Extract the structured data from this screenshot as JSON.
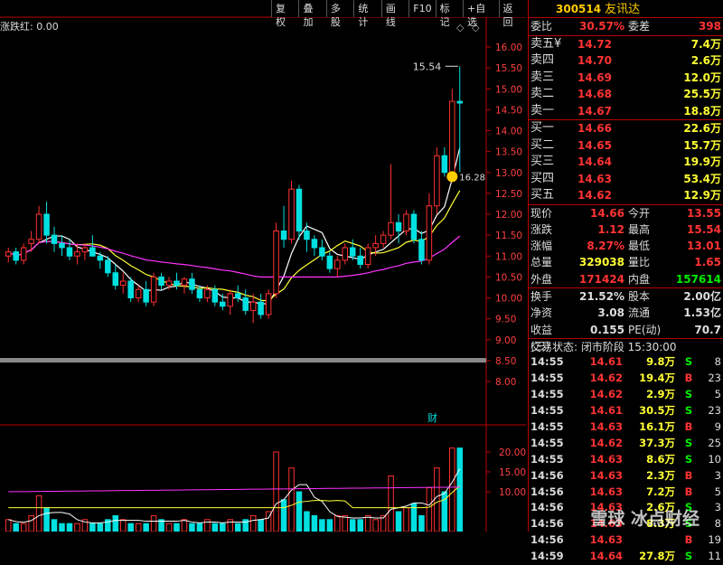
{
  "toolbar": [
    "复权",
    "叠加",
    "多股",
    "统计",
    "画线",
    "F10",
    "标记",
    "+自选",
    "返回"
  ],
  "chart": {
    "indicator_label": "涨跌红: 0.00",
    "y_ticks": [
      "16.00",
      "15.50",
      "15.00",
      "14.50",
      "14.00",
      "13.50",
      "13.00",
      "12.50",
      "12.00",
      "11.50",
      "11.00",
      "10.50",
      "10.00",
      "9.50",
      "9.00",
      "8.50",
      "8.00"
    ],
    "vol_ticks": [
      "20.00",
      "15.00",
      "10.00"
    ],
    "high_annotation": "15.54",
    "ma_annotation": "16.28",
    "fin_marker": "财",
    "colors": {
      "up": "#ff3030",
      "down": "#00e0e0",
      "ma1": "#ffffff",
      "ma2": "#ffff33",
      "ma3": "#ff33ff"
    }
  },
  "stock": {
    "code": "300514",
    "name": "友讯达"
  },
  "order_book": {
    "weibi_label": "委比",
    "weibi_value": "30.57%",
    "weicha_label": "委差",
    "weicha_value": "398",
    "asks": [
      {
        "label": "卖五",
        "price": "14.72",
        "vol": "7.4万",
        "mark": "¥"
      },
      {
        "label": "卖四",
        "price": "14.70",
        "vol": "2.6万",
        "mark": ""
      },
      {
        "label": "卖三",
        "price": "14.69",
        "vol": "12.0万",
        "mark": ""
      },
      {
        "label": "卖二",
        "price": "14.68",
        "vol": "25.5万",
        "mark": ""
      },
      {
        "label": "卖一",
        "price": "14.67",
        "vol": "18.8万",
        "mark": ""
      }
    ],
    "bids": [
      {
        "label": "买一",
        "price": "14.66",
        "vol": "22.6万"
      },
      {
        "label": "买二",
        "price": "14.65",
        "vol": "15.7万"
      },
      {
        "label": "买三",
        "price": "14.64",
        "vol": "19.9万"
      },
      {
        "label": "买四",
        "price": "14.63",
        "vol": "53.4万"
      },
      {
        "label": "买五",
        "price": "14.62",
        "vol": "12.9万"
      }
    ]
  },
  "quote": [
    {
      "k1": "现价",
      "v1": "14.66",
      "c1": "red",
      "k2": "今开",
      "v2": "13.55",
      "c2": "red"
    },
    {
      "k1": "涨跌",
      "v1": "1.12",
      "c1": "red",
      "k2": "最高",
      "v2": "15.54",
      "c2": "red"
    },
    {
      "k1": "涨幅",
      "v1": "8.27%",
      "c1": "red",
      "k2": "最低",
      "v2": "13.01",
      "c2": "red"
    },
    {
      "k1": "总量",
      "v1": "329038",
      "c1": "yellow",
      "k2": "量比",
      "v2": "1.65",
      "c2": "red"
    },
    {
      "k1": "外盘",
      "v1": "171424",
      "c1": "red",
      "k2": "内盘",
      "v2": "157614",
      "c2": "green"
    }
  ],
  "quote2": [
    {
      "k1": "换手",
      "v1": "21.52%",
      "k2": "股本",
      "v2": "2.00亿"
    },
    {
      "k1": "净资",
      "v1": "3.08",
      "k2": "流通",
      "v2": "1.53亿"
    },
    {
      "k1": "收益(三)",
      "v1": "0.155",
      "k2": "PE(动)",
      "v2": "70.7"
    }
  ],
  "trade_status": "交易状态: 闭市阶段 15:30:00",
  "trades": [
    {
      "t": "14:55",
      "p": "14.61",
      "v": "9.8万",
      "bs": "S",
      "n": "8"
    },
    {
      "t": "14:55",
      "p": "14.62",
      "v": "19.4万",
      "bs": "B",
      "n": "23"
    },
    {
      "t": "14:55",
      "p": "14.62",
      "v": "2.9万",
      "bs": "S",
      "n": "5"
    },
    {
      "t": "14:55",
      "p": "14.61",
      "v": "30.5万",
      "bs": "S",
      "n": "23"
    },
    {
      "t": "14:55",
      "p": "14.63",
      "v": "16.1万",
      "bs": "B",
      "n": "9"
    },
    {
      "t": "14:55",
      "p": "14.62",
      "v": "37.3万",
      "bs": "S",
      "n": "25"
    },
    {
      "t": "14:55",
      "p": "14.63",
      "v": "8.6万",
      "bs": "S",
      "n": "10"
    },
    {
      "t": "14:56",
      "p": "14.63",
      "v": "2.3万",
      "bs": "B",
      "n": "3"
    },
    {
      "t": "14:56",
      "p": "14.63",
      "v": "7.2万",
      "bs": "B",
      "n": "5"
    },
    {
      "t": "14:56",
      "p": "14.63",
      "v": "2.6万",
      "bs": "S",
      "n": "3"
    },
    {
      "t": "14:56",
      "p": "14.63",
      "v": "8.3万",
      "bs": "S",
      "n": "8"
    },
    {
      "t": "14:56",
      "p": "14.63",
      "v": "",
      "bs": "B",
      "n": "19"
    },
    {
      "t": "14:59",
      "p": "14.64",
      "v": "27.8万",
      "bs": "S",
      "n": "11"
    }
  ],
  "watermark": "雪球 冰点财经",
  "chart_data": {
    "type": "candlestick",
    "ohlc": [
      [
        11.0,
        11.2,
        10.85,
        11.1
      ],
      [
        11.1,
        11.2,
        10.8,
        10.9
      ],
      [
        10.9,
        11.3,
        10.8,
        11.2
      ],
      [
        11.3,
        11.6,
        11.1,
        11.4
      ],
      [
        11.4,
        12.2,
        11.3,
        12.0
      ],
      [
        12.0,
        12.3,
        11.3,
        11.5
      ],
      [
        11.5,
        11.7,
        11.1,
        11.3
      ],
      [
        11.3,
        11.5,
        11.0,
        11.2
      ],
      [
        11.2,
        11.4,
        10.9,
        11.0
      ],
      [
        11.0,
        11.3,
        10.8,
        11.1
      ],
      [
        11.1,
        11.3,
        10.9,
        11.2
      ],
      [
        11.2,
        11.5,
        11.1,
        11.0
      ],
      [
        11.0,
        11.1,
        10.7,
        10.9
      ],
      [
        10.9,
        11.0,
        10.5,
        10.6
      ],
      [
        10.6,
        10.8,
        10.2,
        10.3
      ],
      [
        10.3,
        10.6,
        10.1,
        10.4
      ],
      [
        10.4,
        10.5,
        9.9,
        10.0
      ],
      [
        10.0,
        10.3,
        9.9,
        10.2
      ],
      [
        10.2,
        10.4,
        9.8,
        9.9
      ],
      [
        9.9,
        10.6,
        9.8,
        10.5
      ],
      [
        10.5,
        10.6,
        10.2,
        10.3
      ],
      [
        10.3,
        10.5,
        10.2,
        10.4
      ],
      [
        10.4,
        10.6,
        10.2,
        10.3
      ],
      [
        10.3,
        10.5,
        10.1,
        10.45
      ],
      [
        10.45,
        10.6,
        10.1,
        10.2
      ],
      [
        10.2,
        10.3,
        9.9,
        10.0
      ],
      [
        10.0,
        10.3,
        9.9,
        10.2
      ],
      [
        10.2,
        10.3,
        9.8,
        9.9
      ],
      [
        9.9,
        10.1,
        9.7,
        9.8
      ],
      [
        9.8,
        10.2,
        9.6,
        10.1
      ],
      [
        10.1,
        10.3,
        9.9,
        10.0
      ],
      [
        10.0,
        10.2,
        9.6,
        9.7
      ],
      [
        9.7,
        10.1,
        9.4,
        9.9
      ],
      [
        9.9,
        10.1,
        9.5,
        9.6
      ],
      [
        9.6,
        10.2,
        9.5,
        10.1
      ],
      [
        10.1,
        11.8,
        10.0,
        11.6
      ],
      [
        11.6,
        12.2,
        11.2,
        11.4
      ],
      [
        11.4,
        12.8,
        11.3,
        12.6
      ],
      [
        12.6,
        12.7,
        11.4,
        11.6
      ],
      [
        11.6,
        11.8,
        11.1,
        11.4
      ],
      [
        11.4,
        11.5,
        11.0,
        11.2
      ],
      [
        11.2,
        11.4,
        10.9,
        11.0
      ],
      [
        11.0,
        11.1,
        10.6,
        10.7
      ],
      [
        10.7,
        11.0,
        10.5,
        10.9
      ],
      [
        10.9,
        11.3,
        10.8,
        11.2
      ],
      [
        11.2,
        11.4,
        10.9,
        11.0
      ],
      [
        11.0,
        11.2,
        10.7,
        10.8
      ],
      [
        10.8,
        11.3,
        10.7,
        11.2
      ],
      [
        11.2,
        11.5,
        11.0,
        11.3
      ],
      [
        11.3,
        11.6,
        11.2,
        11.5
      ],
      [
        11.5,
        13.2,
        11.4,
        11.8
      ],
      [
        11.8,
        12.0,
        11.3,
        11.6
      ],
      [
        11.6,
        12.1,
        11.5,
        12.0
      ],
      [
        12.0,
        12.1,
        11.3,
        11.4
      ],
      [
        11.4,
        11.6,
        10.8,
        10.9
      ],
      [
        10.9,
        12.5,
        10.8,
        12.2
      ],
      [
        12.2,
        13.6,
        12.0,
        13.4
      ],
      [
        13.4,
        13.6,
        12.9,
        13.0
      ],
      [
        13.0,
        15.0,
        12.8,
        14.7
      ],
      [
        14.7,
        15.54,
        13.01,
        14.66
      ]
    ],
    "volume": [
      3,
      2,
      2,
      4,
      9,
      6,
      3,
      2,
      2,
      2,
      3,
      2,
      2,
      3,
      4,
      3,
      2,
      2,
      2,
      4,
      3,
      2,
      2,
      3,
      2,
      2,
      3,
      2,
      2,
      3,
      2,
      3,
      4,
      3,
      5,
      20,
      8,
      16,
      10,
      5,
      4,
      3,
      3,
      4,
      4,
      3,
      3,
      4,
      3,
      4,
      14,
      5,
      6,
      7,
      4,
      11,
      16,
      10,
      21,
      21
    ]
  }
}
